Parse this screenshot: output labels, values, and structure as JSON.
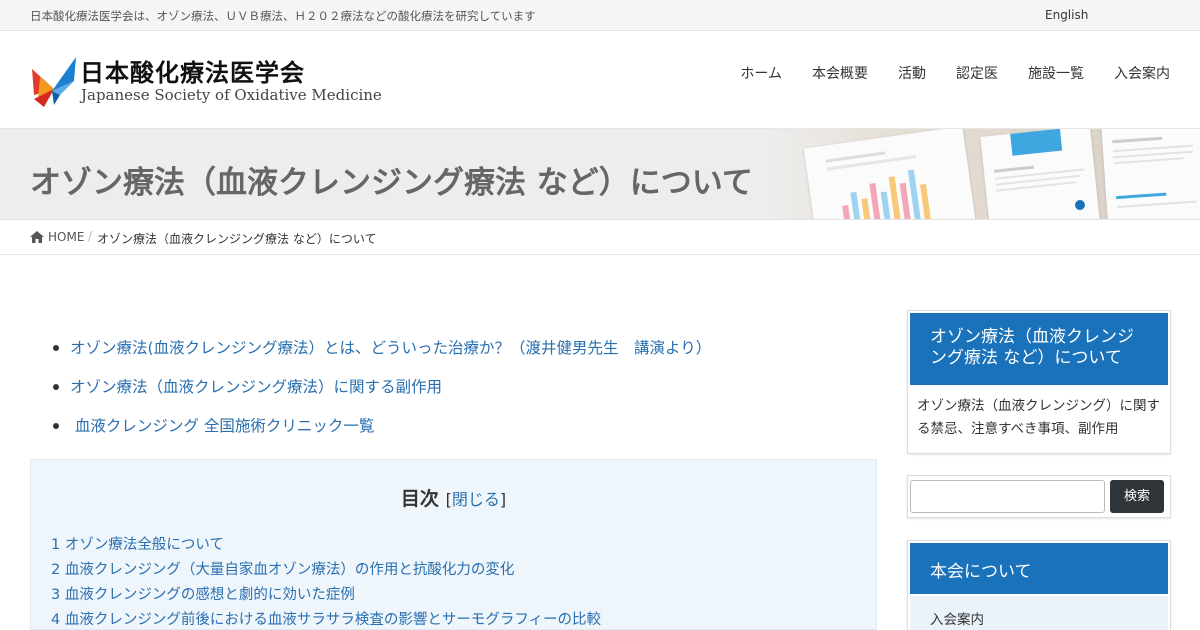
{
  "topbar": {
    "description": "日本酸化療法医学会は、オゾン療法、ＵＶＢ療法、Ｈ２０２療法などの酸化療法を研究しています",
    "language_link": "English"
  },
  "logo": {
    "name_jp": "日本酸化療法医学会",
    "name_en": "Japanese Society of Oxidative Medicine"
  },
  "nav": {
    "items": [
      "ホーム",
      "本会概要",
      "活動",
      "認定医",
      "施設一覧",
      "入会案内"
    ]
  },
  "banner": {
    "title": "オゾン療法（血液クレンジング療法 など）について"
  },
  "breadcrumb": {
    "home": "HOME",
    "separator": "/",
    "current": "オゾン療法（血液クレンジング療法 など）について"
  },
  "links": [
    "オゾン療法(血液クレンジング療法）とは、どういった治療か？（渡井健男先生　講演より）",
    "オゾン療法（血液クレンジング療法）に関する副作用",
    " 血液クレンジング 全国施術クリニック一覧"
  ],
  "toc": {
    "title": "目次",
    "toggle_open": "[",
    "toggle_label": "閉じる",
    "toggle_close": "]",
    "items": [
      "1 オゾン療法全般について",
      "2 血液クレンジング（大量自家血オゾン療法）の作用と抗酸化力の変化",
      "3 血液クレンジングの感想と劇的に効いた症例",
      "4 血液クレンジング前後における血液サラサラ検査の影響とサーモグラフィーの比較"
    ]
  },
  "sidebar": {
    "widget1": {
      "title": "オゾン療法（血液クレンジング療法 など）について",
      "body": "オゾン療法（血液クレンジング）に関する禁忌、注意すべき事項、副作用"
    },
    "search": {
      "button": "検索"
    },
    "widget3": {
      "title": "本会について",
      "items": [
        "入会案内"
      ]
    }
  },
  "colors": {
    "accent_blue": "#1a72bb",
    "link_blue": "#2a6fb0",
    "toc_background": "#eef5fb",
    "search_button": "#2f3439"
  }
}
